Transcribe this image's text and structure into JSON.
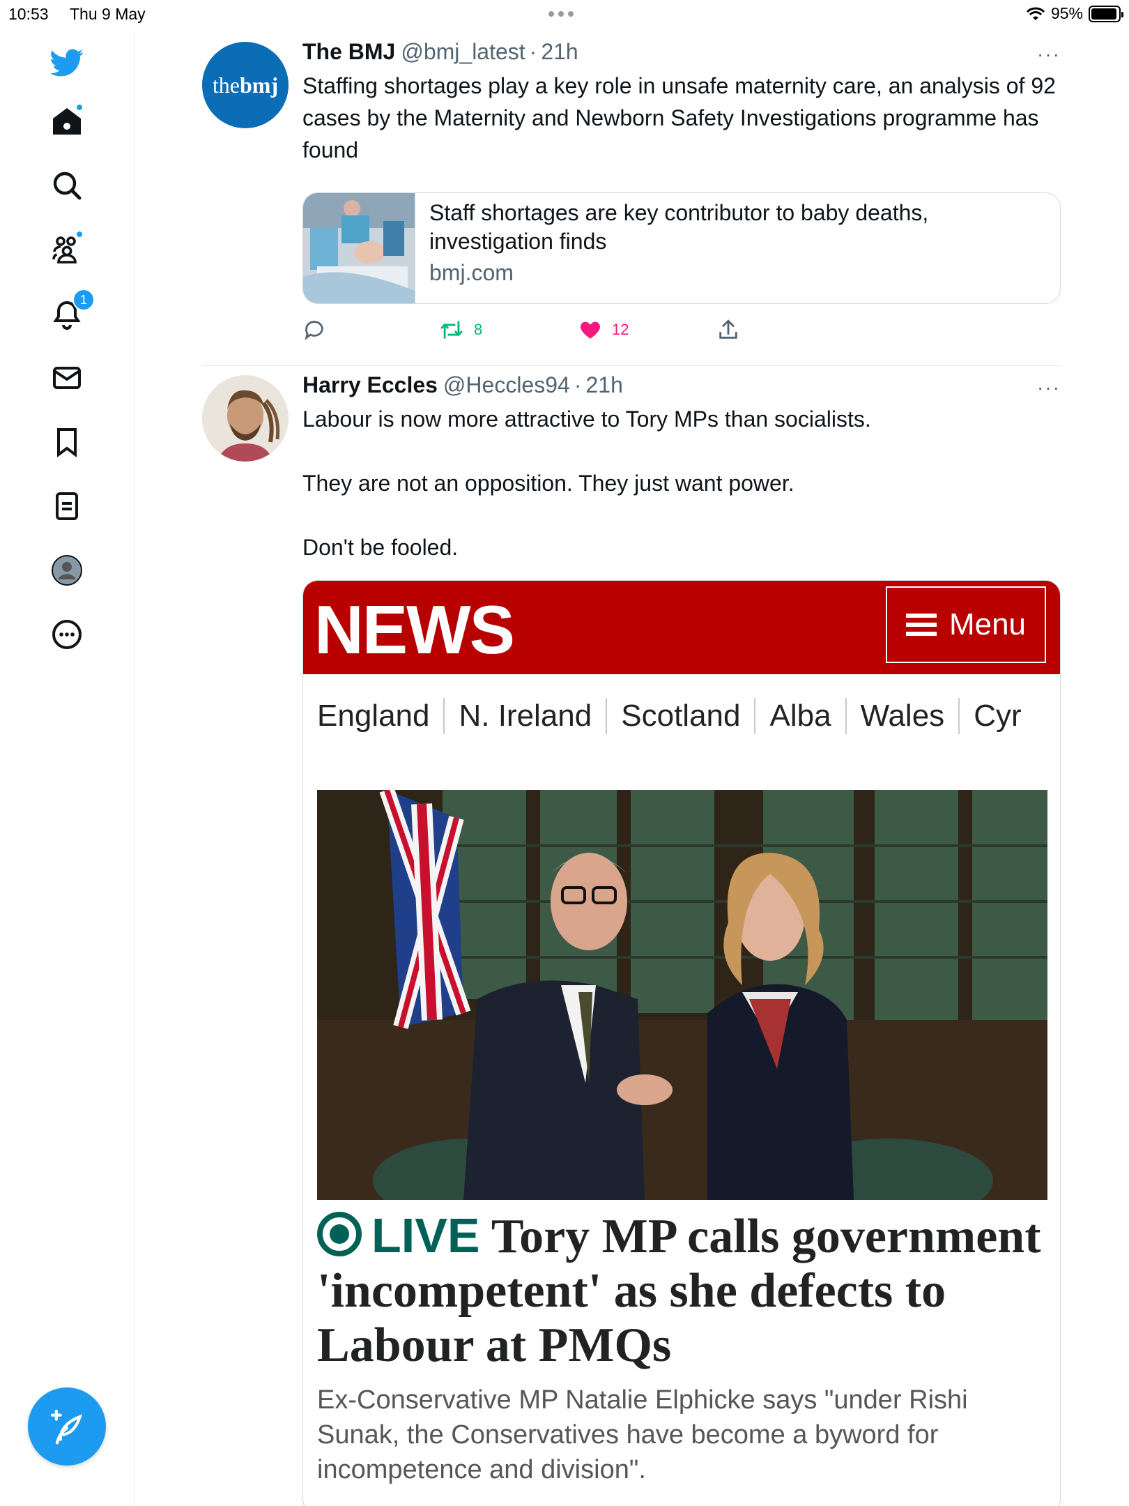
{
  "status_bar": {
    "time": "10:53",
    "date": "Thu 9 May",
    "battery": "95%"
  },
  "sidebar": {
    "notifications_badge": "1"
  },
  "tweets": [
    {
      "name": "The BMJ",
      "handle": "@bmj_latest",
      "dot": "·",
      "time": "21h",
      "more": "···",
      "avatar_text": {
        "a": "the",
        "b": "bmj"
      },
      "text": "Staffing shortages play a key role in unsafe maternity care, an analysis of 92 cases by the Maternity and Newborn Safety Investigations programme has found",
      "card": {
        "title": "Staff shortages are key contributor to baby deaths, investigation finds",
        "domain": "bmj.com"
      },
      "retweets": "8",
      "likes": "12"
    },
    {
      "name": "Harry Eccles",
      "handle": "@Heccles94",
      "dot": "·",
      "time": "21h",
      "more": "···",
      "lines": [
        "Labour is now more attractive to Tory MPs than socialists.",
        "They are not an opposition. They just want power.",
        "Don't be fooled."
      ],
      "news": {
        "logo": "NEWS",
        "menu": "Menu",
        "nav": [
          "England",
          "N. Ireland",
          "Scotland",
          "Alba",
          "Wales",
          "Cyr"
        ],
        "live": "LIVE",
        "headline": "Tory MP calls government 'incompetent' as she defects to Labour at PMQs",
        "summary": "Ex-Conservative MP Natalie Elphicke says \"under Rishi Sunak, the Conservatives have become a byword for incompetence and division\"."
      }
    }
  ],
  "colors": {
    "twitter_blue": "#1d9bf0",
    "retweet_green": "#00ba7c",
    "like_pink": "#f91880",
    "bbc_red": "#b80000",
    "live_teal": "#006157"
  },
  "icons": [
    "twitter-logo-icon",
    "home-icon",
    "search-icon",
    "communities-icon",
    "notifications-bell-icon",
    "messages-envelope-icon",
    "bookmark-icon",
    "lists-icon",
    "profile-icon",
    "more-circle-icon",
    "compose-feather-icon",
    "reply-icon",
    "retweet-icon",
    "heart-icon",
    "share-icon"
  ]
}
